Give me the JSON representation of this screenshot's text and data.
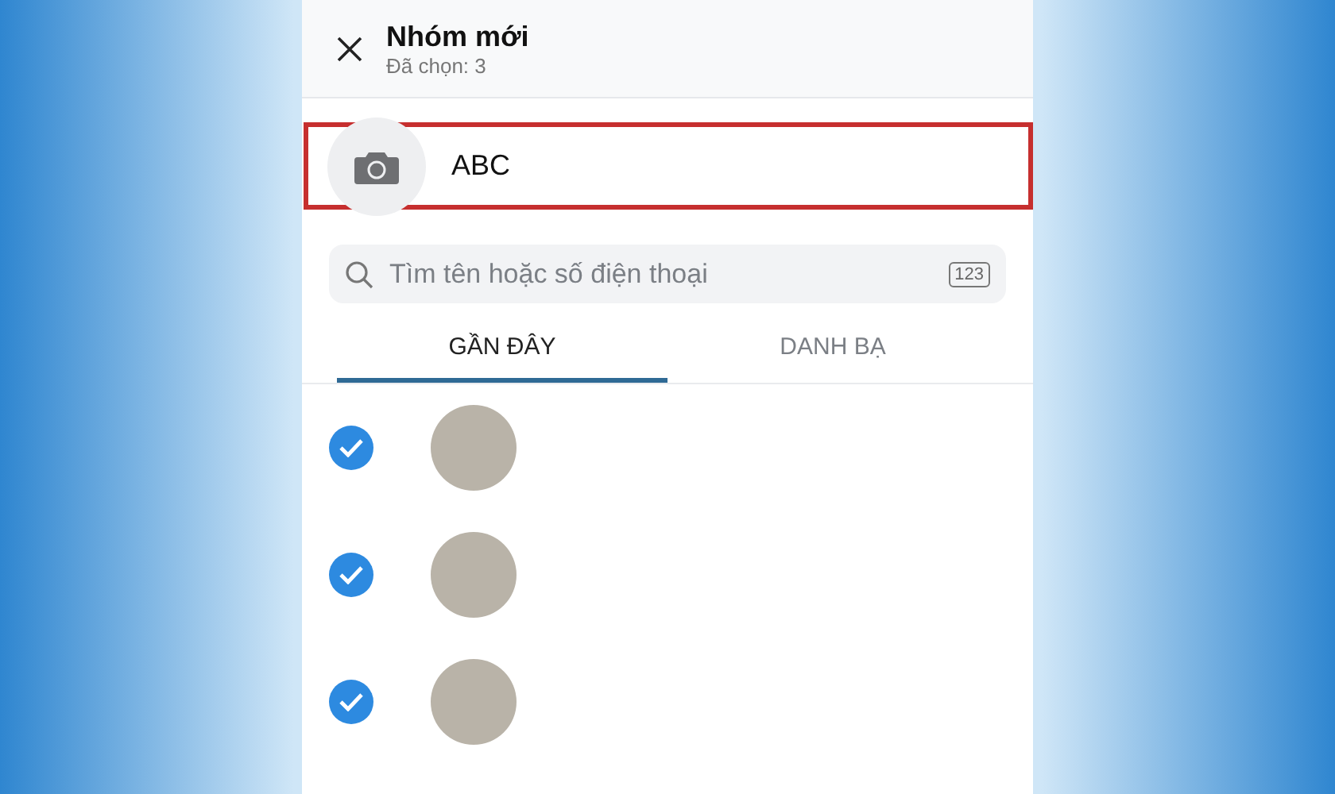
{
  "header": {
    "title": "Nhóm mới",
    "subtitle": "Đã chọn: 3"
  },
  "group_name": {
    "value": "ABC"
  },
  "search": {
    "placeholder": "Tìm tên hoặc số điện thoại",
    "keypad_label": "123"
  },
  "tabs": [
    {
      "label": "GẦN ĐÂY",
      "selected": true
    },
    {
      "label": "DANH BẠ",
      "selected": false
    }
  ],
  "contacts": [
    {
      "checked": true
    },
    {
      "checked": true
    },
    {
      "checked": true
    }
  ]
}
